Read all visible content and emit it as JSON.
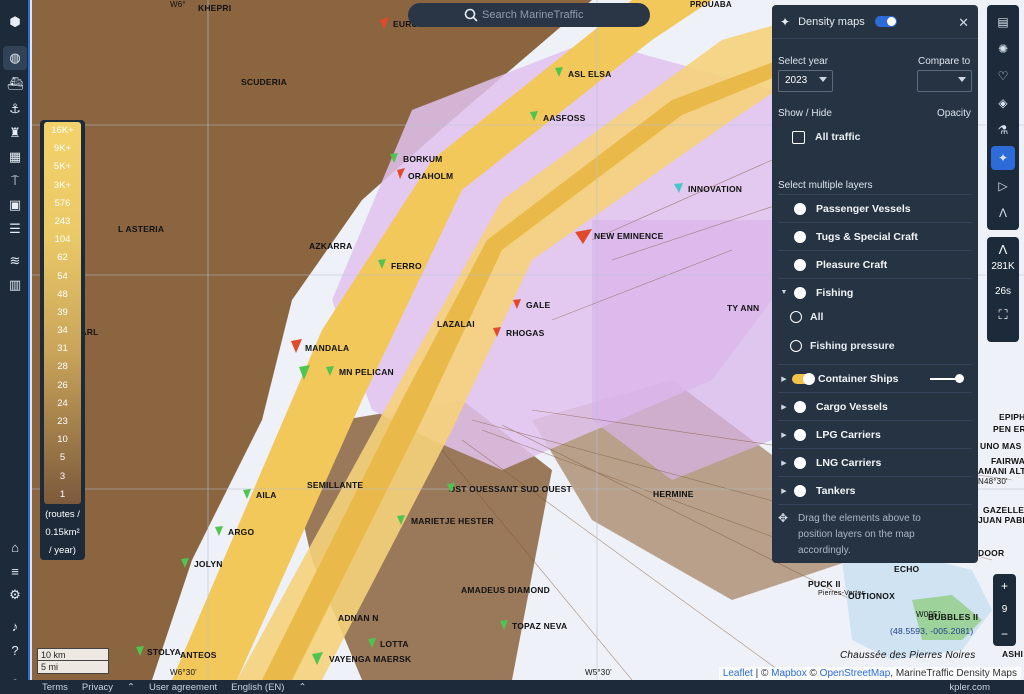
{
  "search": {
    "placeholder": "Search MarineTraffic"
  },
  "legend": {
    "ticks": [
      "16K+",
      "9K+",
      "5K+",
      "3K+",
      "576",
      "243",
      "104",
      "62",
      "54",
      "48",
      "39",
      "34",
      "31",
      "28",
      "26",
      "24",
      "23",
      "10",
      "5",
      "3",
      "1"
    ],
    "unit_line1": "(routes /",
    "unit_line2": "0.15km²",
    "unit_line3": "/ year)"
  },
  "scale": {
    "km": "10 km",
    "mi": "5 mi"
  },
  "ships": [
    {
      "name": "KHEPRI",
      "color": "#7ad17a"
    },
    {
      "name": "EURO NABER",
      "color": "#e04a2b"
    },
    {
      "name": "SCUDERIA",
      "color": "#e87c2b"
    },
    {
      "name": "ASL ELSA",
      "color": "#4fc44f"
    },
    {
      "name": "AASFOSS",
      "color": "#4fc44f"
    },
    {
      "name": "BORKUM",
      "color": "#4fc44f"
    },
    {
      "name": "ORAHOLM",
      "color": "#e04a2b"
    },
    {
      "name": "INNOVATION",
      "color": "#49c6c9"
    },
    {
      "name": "L ASTERIA",
      "color": "#e87c2b"
    },
    {
      "name": "AZKARRA",
      "color": "#e87c2b"
    },
    {
      "name": "NEW EMINENCE",
      "color": "#e04a2b"
    },
    {
      "name": "FERRO",
      "color": "#4fc44f"
    },
    {
      "name": "GALE",
      "color": "#e04a2b"
    },
    {
      "name": "TY ANN",
      "color": "#e87c2b"
    },
    {
      "name": "EW PEARL",
      "color": "#e87c2b"
    },
    {
      "name": "LAZALAI",
      "color": "#e87c2b"
    },
    {
      "name": "RHOGAS",
      "color": "#e04a2b"
    },
    {
      "name": "MANDALA",
      "color": "#e04a2b"
    },
    {
      "name": "MN PELICAN",
      "color": "#4fc44f"
    },
    {
      "name": "SEMILLANTE",
      "color": "#e87c2b"
    },
    {
      "name": "DST OUESSANT SUD OUEST",
      "color": "#4fc44f"
    },
    {
      "name": "HERMINE",
      "color": "#e87c2b"
    },
    {
      "name": "AILA",
      "color": "#4fc44f"
    },
    {
      "name": "MARIETJE HESTER",
      "color": "#4fc44f"
    },
    {
      "name": "ARGO",
      "color": "#4fc44f"
    },
    {
      "name": "JOLYN",
      "color": "#4fc44f"
    },
    {
      "name": "AMADEUS DIAMOND",
      "color": "#4fc44f"
    },
    {
      "name": "ADNAN N",
      "color": "#4fc44f"
    },
    {
      "name": "TOPAZ NEVA",
      "color": "#4fc44f"
    },
    {
      "name": "LOTTA",
      "color": "#4fc44f"
    },
    {
      "name": "STOLYA",
      "color": "#4fc44f"
    },
    {
      "name": "ANTEOS",
      "color": "#4fc44f"
    },
    {
      "name": "VAYENGA MAERSK",
      "color": "#4fc44f"
    },
    {
      "name": "ECHO",
      "color": "#9a5fd6"
    },
    {
      "name": "PUCK II",
      "color": "#9a5fd6"
    },
    {
      "name": "OUTIONOX",
      "color": "#9a5fd6"
    },
    {
      "name": "BUBBLES II",
      "color": "#9a5fd6"
    }
  ],
  "map_text": {
    "coord_w6": "W6°",
    "coord_w630": "W6°30'",
    "coord_w530": "W5°30'",
    "prouaba": "PROUABA",
    "coords_box": "(48.5593, -005.2081)",
    "chaussee": "Chaussée des Pierres Noires",
    "pierres_vertes": "Pierres-Vertes",
    "w005": "W005°",
    "epiph": "EPIPH",
    "pen_er": "PEN ER",
    "uno_mas": "UNO MAS",
    "fairwa": "FAIRWA",
    "amani": "AMANI ALT",
    "w48": "N48°30'",
    "gazelle": "GAZELLE O",
    "juan": "JUAN PABL",
    "door": "DOOR",
    "ashi": "ASHI"
  },
  "attribution": {
    "leaflet": "Leaflet",
    "c1": " | © ",
    "mapbox": "Mapbox",
    "c2": " © ",
    "osm": "OpenStreetMap",
    "c3": ", MarineTraffic Density Maps"
  },
  "bottom": {
    "terms": "Terms",
    "privacy": "Privacy",
    "user_agreement": "User agreement",
    "language": "English (EN)",
    "brand": "kpler.com"
  },
  "right_rail": {
    "ships_count": "281K",
    "time": "26s"
  },
  "zoom": {
    "plus": "+",
    "level": "9",
    "minus": "−"
  },
  "panel": {
    "title": "Density maps",
    "select_year_label": "Select year",
    "compare_label": "Compare to",
    "year_value": "2023",
    "compare_value": "",
    "show_hide": "Show / Hide",
    "opacity": "Opacity",
    "all_traffic": "All traffic",
    "multiple_layers": "Select multiple layers",
    "layers": [
      "Passenger Vessels",
      "Tugs & Special Craft",
      "Pleasure Craft",
      "Fishing"
    ],
    "fishing_sub": [
      "All",
      "Fishing pressure"
    ],
    "layers2": [
      "Container Ships",
      "Cargo Vessels",
      "LPG Carriers",
      "LNG Carriers",
      "Tankers"
    ],
    "drag_hint": "Drag the elements above to position layers on the map accordingly."
  },
  "colors": {
    "brand_blue": "#2c6bd8",
    "panel_bg": "#263342",
    "rail_bg": "#1c2a3a",
    "route_brown": "#8b6440",
    "route_yellow": "#f3c85a",
    "zone_pink": "#e0c2ee"
  }
}
